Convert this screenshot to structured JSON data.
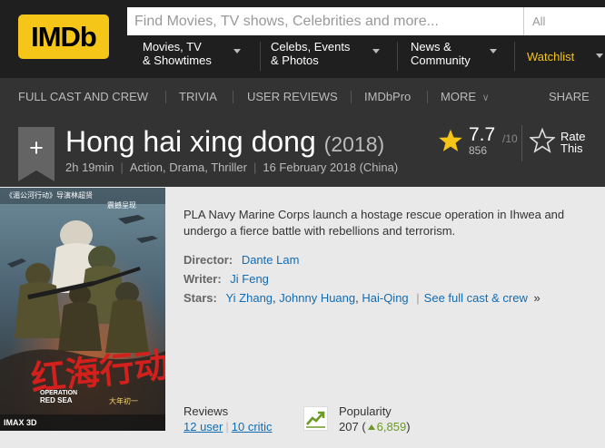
{
  "logo": "IMDb",
  "search": {
    "placeholder": "Find Movies, TV shows, Celebrities and more...",
    "category": "All"
  },
  "nav": {
    "movies_tv_1": "Movies, TV",
    "movies_tv_2": "& Showtimes",
    "celebs_1": "Celebs, Events",
    "celebs_2": "& Photos",
    "news_1": "News &",
    "news_2": "Community",
    "watchlist": "Watchlist"
  },
  "subnav": {
    "full_cast": "FULL CAST AND CREW",
    "trivia": "TRIVIA",
    "user_reviews": "USER REVIEWS",
    "imdbpro": "IMDbPro",
    "more": "MORE",
    "share": "SHARE"
  },
  "title": {
    "name": "Hong hai xing dong",
    "year": "(2018)",
    "runtime": "2h 19min",
    "genres": "Action, Drama, Thriller",
    "release": "16 February 2018 (China)"
  },
  "rating": {
    "value": "7.7",
    "max": "/10",
    "votes": "856",
    "rate_line1": "Rate",
    "rate_line2": "This"
  },
  "poster": {
    "tagline": "《湄公河行动》导演林超贤",
    "tagline2": "震撼呈现",
    "title_cn": "红海行动",
    "title_en1": "OPERATION",
    "title_en2": "RED SEA",
    "bottom": "IMAX 3D",
    "date": "大年初一"
  },
  "plot": "PLA Navy Marine Corps launch a hostage rescue operation in Ihwea and undergo a fierce battle with rebellions and terrorism.",
  "credits": {
    "director_label": "Director:",
    "director": "Dante Lam",
    "writer_label": "Writer:",
    "writer": "Ji Feng",
    "stars_label": "Stars:",
    "star1": "Yi Zhang",
    "star2": "Johnny Huang",
    "star3": "Hai-Qing",
    "see_full": "See full cast & crew",
    "see_full_arrow": "»"
  },
  "reviews": {
    "label": "Reviews",
    "user": "12 user",
    "critic": "10 critic"
  },
  "popularity": {
    "label": "Popularity",
    "rank": "207",
    "delta": "6,859"
  },
  "colors": {
    "brand": "#f5c518",
    "link": "#136cb2",
    "up": "#6a9a23"
  }
}
